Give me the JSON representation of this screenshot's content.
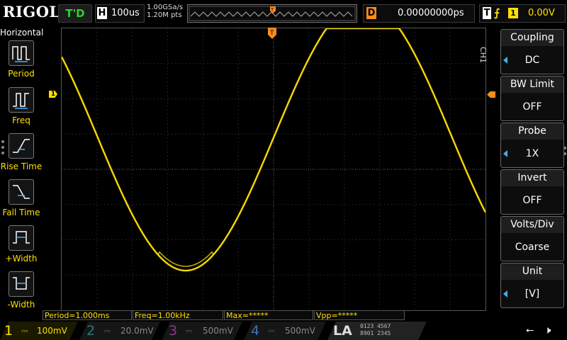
{
  "brand": "RIGOL",
  "topbar": {
    "status": "T'D",
    "timebase_label": "H",
    "timebase_value": "100us",
    "sample_rate": "1.00GSa/s",
    "memory_depth": "1.20M pts",
    "delay_label": "D",
    "delay_value": "0.00000000ps",
    "trigger_label": "T",
    "trigger_source": "1",
    "trigger_level": "0.00V"
  },
  "left_menu": {
    "title": "Horizontal",
    "items": [
      {
        "label": "Period",
        "icon": "period-icon"
      },
      {
        "label": "Freq",
        "icon": "frequency-icon"
      },
      {
        "label": "Rise Time",
        "icon": "rise-time-icon"
      },
      {
        "label": "Fall Time",
        "icon": "fall-time-icon"
      },
      {
        "label": "+Width",
        "icon": "positive-width-icon"
      },
      {
        "label": "-Width",
        "icon": "negative-width-icon"
      }
    ]
  },
  "channel_tag": "CH1",
  "right_menu": [
    {
      "label": "Coupling",
      "value": "DC"
    },
    {
      "label": "BW Limit",
      "value": "OFF"
    },
    {
      "label": "Probe",
      "value": "1X"
    },
    {
      "label": "Invert",
      "value": "OFF"
    },
    {
      "label": "Volts/Div",
      "value": "Coarse"
    },
    {
      "label": "Unit",
      "value": "[V]"
    }
  ],
  "measurements": [
    {
      "text": "Period=1.000ms"
    },
    {
      "text": "Freq=1.00kHz"
    },
    {
      "text": "Max=*****"
    },
    {
      "text": "Vpp=*****"
    }
  ],
  "channels": [
    {
      "num": "1",
      "scale": "100mV",
      "color": "#ffe000",
      "active": true
    },
    {
      "num": "2",
      "scale": "20.0mV",
      "color": "#00b5a8",
      "active": false
    },
    {
      "num": "3",
      "scale": "500mV",
      "color": "#d14bd6",
      "active": false
    },
    {
      "num": "4",
      "scale": "500mV",
      "color": "#3f8bff",
      "active": false
    }
  ],
  "la": {
    "label": "LA",
    "row1": "0123 4567",
    "row2": "8901 2345"
  },
  "colors": {
    "trace": "#ffe000",
    "status": "#2fd12f",
    "trigger_marker": "#ff8c1a",
    "grid": "#3a3a3a"
  }
}
